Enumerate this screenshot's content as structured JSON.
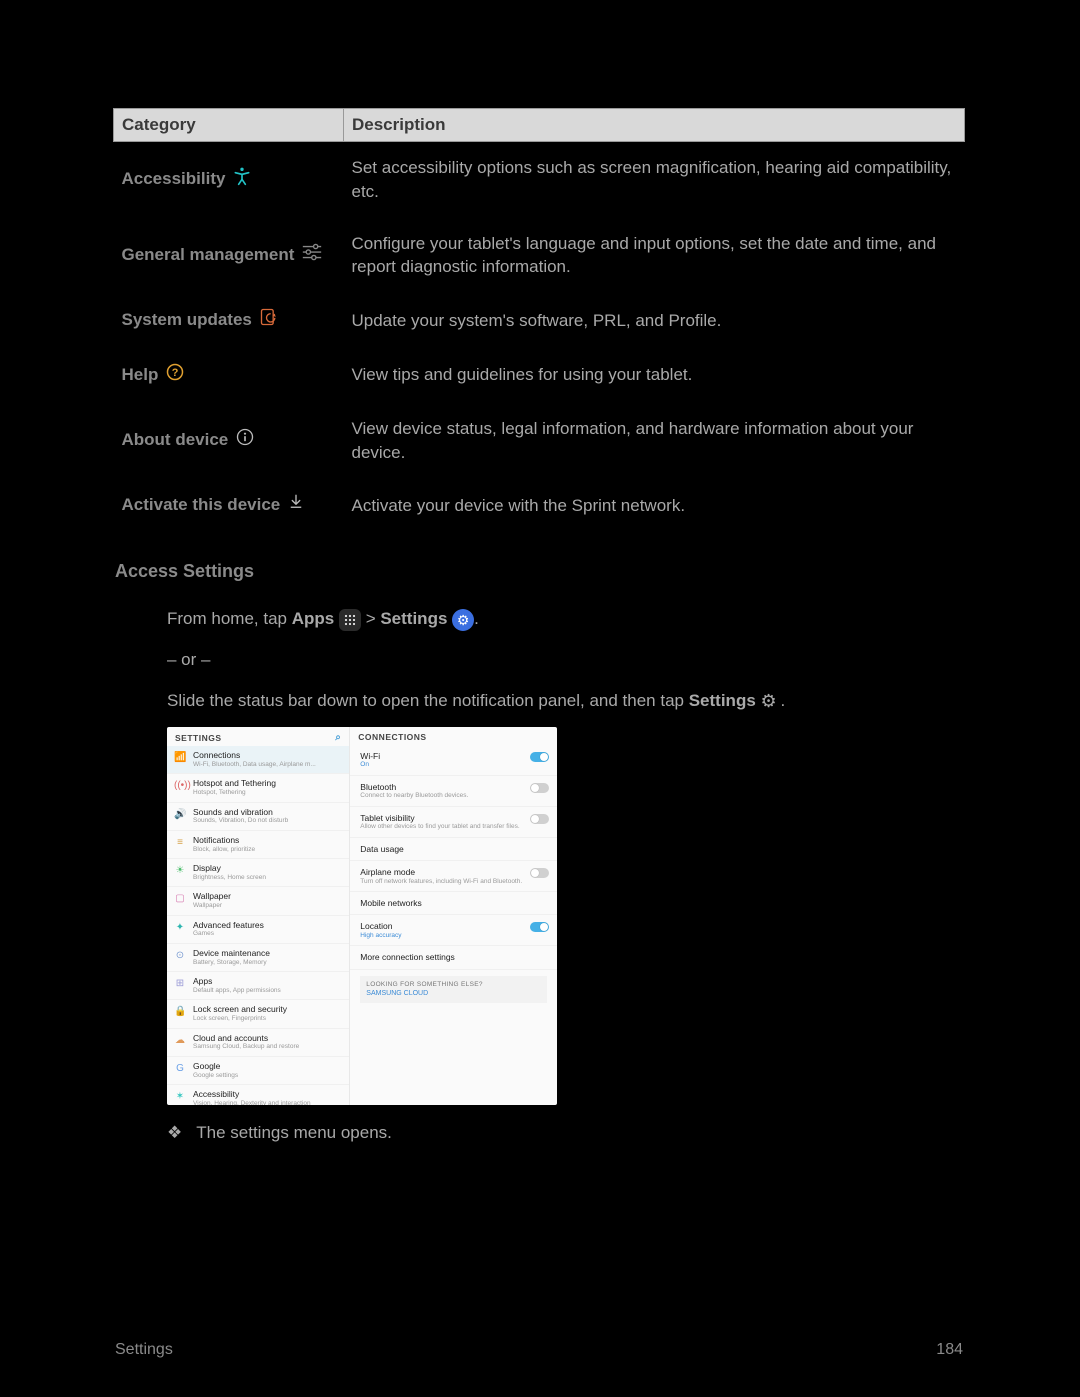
{
  "table": {
    "header": {
      "category": "Category",
      "description": "Description"
    },
    "rows": [
      {
        "cat": "Accessibility",
        "desc": "Set accessibility options such as screen magnification, hearing aid compatibility, etc."
      },
      {
        "cat": "General management",
        "desc": "Configure your tablet's language and input options, set the date and time, and report diagnostic information."
      },
      {
        "cat": "System updates",
        "desc": "Update your system's software, PRL, and Profile."
      },
      {
        "cat": "Help",
        "desc": "View tips and guidelines for using your tablet."
      },
      {
        "cat": "About device",
        "desc": "View device status, legal information, and hardware information about your device."
      },
      {
        "cat": "Activate this device",
        "desc": "Activate your device with the Sprint network."
      }
    ]
  },
  "section_title": "Access Settings",
  "access": {
    "prefix": "From home, tap ",
    "apps_label": "Apps",
    "arrow": " > ",
    "settings_label": "Settings",
    "suffix": "."
  },
  "or_text": "– or –",
  "slide_prefix": "Slide the status bar down to open the notification panel, and then tap ",
  "slide_settings": "Settings",
  "slide_suffix": ".",
  "screenshot": {
    "left_header": "SETTINGS",
    "right_header": "CONNECTIONS",
    "left": [
      {
        "t": "Connections",
        "s": "Wi-Fi, Bluetooth, Data usage, Airplane m...",
        "sel": true,
        "ic": "📶",
        "c": "#25aee2"
      },
      {
        "t": "Hotspot and Tethering",
        "s": "Hotspot, Tethering",
        "ic": "((•))",
        "c": "#d66"
      },
      {
        "t": "Sounds and vibration",
        "s": "Sounds, Vibration, Do not disturb",
        "ic": "🔊",
        "c": "#8e6dd6"
      },
      {
        "t": "Notifications",
        "s": "Block, allow, prioritize",
        "ic": "≡",
        "c": "#d6a24a"
      },
      {
        "t": "Display",
        "s": "Brightness, Home screen",
        "ic": "☀",
        "c": "#4fbf6e"
      },
      {
        "t": "Wallpaper",
        "s": "Wallpaper",
        "ic": "▢",
        "c": "#d67ab0"
      },
      {
        "t": "Advanced features",
        "s": "Games",
        "ic": "✦",
        "c": "#2fb6b0"
      },
      {
        "t": "Device maintenance",
        "s": "Battery, Storage, Memory",
        "ic": "⊙",
        "c": "#7a9bd1"
      },
      {
        "t": "Apps",
        "s": "Default apps, App permissions",
        "ic": "⊞",
        "c": "#9a9ad6"
      },
      {
        "t": "Lock screen and security",
        "s": "Lock screen, Fingerprints",
        "ic": "🔒",
        "c": "#6fbfe0"
      },
      {
        "t": "Cloud and accounts",
        "s": "Samsung Cloud, Backup and restore",
        "ic": "☁",
        "c": "#e09a5a"
      },
      {
        "t": "Google",
        "s": "Google settings",
        "ic": "G",
        "c": "#6aa0e6"
      },
      {
        "t": "Accessibility",
        "s": "Vision, Hearing, Dexterity and interaction",
        "ic": "✶",
        "c": "#36c7c0"
      }
    ],
    "right": [
      {
        "t": "Wi-Fi",
        "s": "On",
        "sb": true,
        "tg": "on"
      },
      {
        "t": "Bluetooth",
        "s": "Connect to nearby Bluetooth devices.",
        "tg": "off"
      },
      {
        "t": "Tablet visibility",
        "s": "Allow other devices to find your tablet and transfer files.",
        "tg": "off"
      },
      {
        "t": "Data usage",
        "s": ""
      },
      {
        "t": "Airplane mode",
        "s": "Turn off network features, including Wi-Fi and Bluetooth.",
        "tg": "off"
      },
      {
        "t": "Mobile networks",
        "s": ""
      },
      {
        "t": "Location",
        "s": "High accuracy",
        "sb": true,
        "tg": "on"
      },
      {
        "t": "More connection settings",
        "s": ""
      }
    ],
    "looking_header": "LOOKING FOR SOMETHING ELSE?",
    "looking_link": "SAMSUNG CLOUD"
  },
  "result_text": "The settings menu opens.",
  "footer": {
    "left": "Settings",
    "right": "184"
  }
}
